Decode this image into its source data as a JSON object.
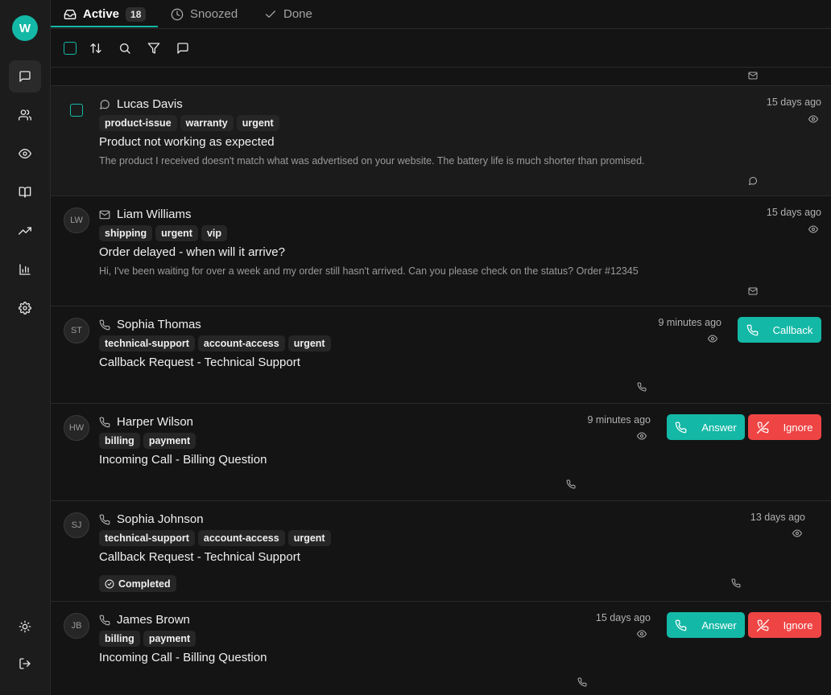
{
  "sidebar": {
    "avatar_initial": "W"
  },
  "tabs": [
    {
      "label": "Active",
      "count": "18"
    },
    {
      "label": "Snoozed"
    },
    {
      "label": "Done"
    }
  ],
  "conversations": [
    {
      "name": "Lucas Davis",
      "channel": "chat",
      "tags": [
        "product-issue",
        "warranty",
        "urgent"
      ],
      "subject": "Product not working as expected",
      "preview": "The product I received doesn't match what was advertised on your website. The battery life is much shorter than promised.",
      "time": "15 days ago"
    },
    {
      "initials": "LW",
      "name": "Liam Williams",
      "channel": "email",
      "tags": [
        "shipping",
        "urgent",
        "vip"
      ],
      "subject": "Order delayed - when will it arrive?",
      "preview": "Hi, I've been waiting for over a week and my order still hasn't arrived. Can you please check on the status? Order #12345",
      "time": "15 days ago"
    },
    {
      "initials": "ST",
      "name": "Sophia Thomas",
      "channel": "phone",
      "tags": [
        "technical-support",
        "account-access",
        "urgent"
      ],
      "subject": "Callback Request - Technical Support",
      "time": "9 minutes ago",
      "action": "Callback"
    },
    {
      "initials": "HW",
      "name": "Harper Wilson",
      "channel": "phone",
      "tags": [
        "billing",
        "payment"
      ],
      "subject": "Incoming Call - Billing Question",
      "time": "9 minutes ago",
      "answer": "Answer",
      "ignore": "Ignore"
    },
    {
      "initials": "SJ",
      "name": "Sophia Johnson",
      "channel": "phone",
      "tags": [
        "technical-support",
        "account-access",
        "urgent"
      ],
      "subject": "Callback Request - Technical Support",
      "time": "13 days ago",
      "status": "Completed"
    },
    {
      "initials": "JB",
      "name": "James Brown",
      "channel": "phone",
      "tags": [
        "billing",
        "payment"
      ],
      "subject": "Incoming Call - Billing Question",
      "time": "15 days ago",
      "answer": "Answer",
      "ignore": "Ignore"
    }
  ],
  "colors": {
    "accent": "#14b8a6",
    "danger": "#ef4444",
    "background": "#141414"
  }
}
